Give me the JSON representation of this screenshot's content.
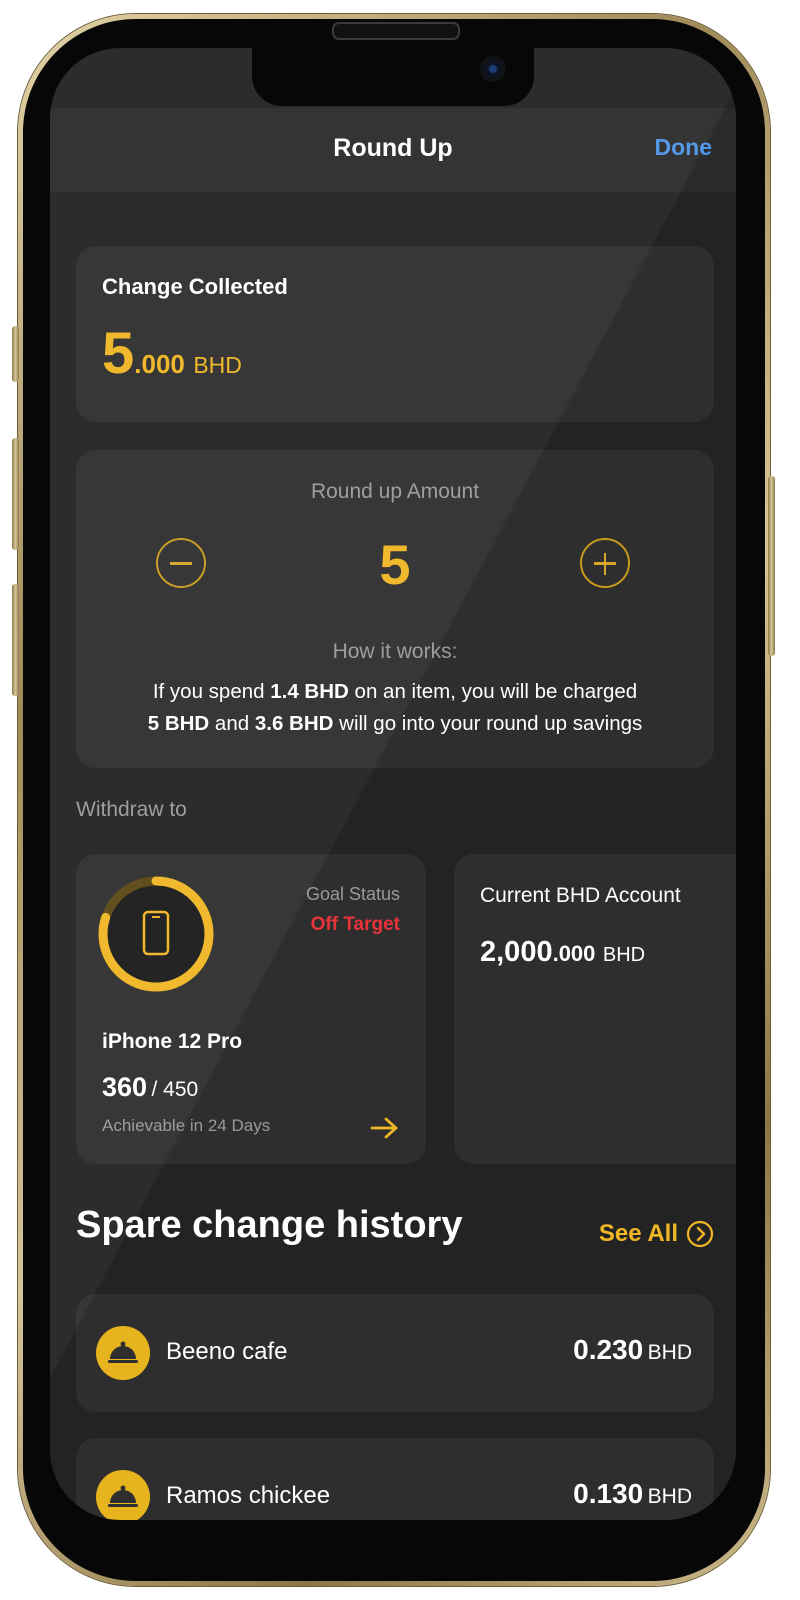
{
  "header": {
    "title": "Round Up",
    "done_label": "Done"
  },
  "change_collected": {
    "label": "Change Collected",
    "whole": "5",
    "decimals": ".000",
    "currency": "BHD"
  },
  "round_up": {
    "label": "Round up Amount",
    "value": "5",
    "how_title": "How it works:",
    "line1_pre": "If you spend ",
    "line1_bold": "1.4 BHD",
    "line1_post": " on an item, you will be charged",
    "line2_bold1": "5 BHD",
    "line2_mid": " and ",
    "line2_bold2": "3.6 BHD",
    "line2_post": " will go into your round up savings"
  },
  "withdraw": {
    "label": "Withdraw to",
    "goal": {
      "status_label": "Goal Status",
      "status_value": "Off Target",
      "name": "iPhone 12 Pro",
      "current": "360",
      "target": "/ 450",
      "note": "Achievable in 24 Days",
      "progress": 0.8
    },
    "account": {
      "name": "Current BHD Account",
      "whole": "2,000",
      "decimals": ".000",
      "currency": "BHD"
    }
  },
  "history": {
    "title": "Spare change history",
    "see_all": "See All",
    "items": [
      {
        "name": "Beeno cafe",
        "amount": "0.230",
        "currency": "BHD",
        "icon": "cloche-icon"
      },
      {
        "name": "Ramos chickee",
        "amount": "0.130",
        "currency": "BHD",
        "icon": "cloche-icon"
      }
    ]
  },
  "colors": {
    "accent": "#f0b624",
    "link": "#4c95e8",
    "alert": "#e8333b",
    "card": "#2e2e2e",
    "background": "#232323"
  }
}
